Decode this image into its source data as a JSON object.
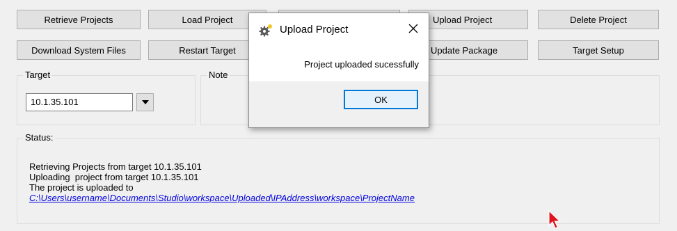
{
  "toolbar": {
    "row1": [
      "Retrieve Projects",
      "Load Project",
      "",
      "Upload Project",
      "Delete Project"
    ],
    "row2": [
      "Download System Files",
      "Restart Target",
      "",
      "Update Package",
      "Target Setup"
    ]
  },
  "target_group": {
    "label": "Target",
    "value": "10.1.35.101"
  },
  "note_group": {
    "label": "Note"
  },
  "status_group": {
    "label": "Status:",
    "lines": [
      "Retrieving Projects from target 10.1.35.101",
      "Uploading  project from target 10.1.35.101",
      "The project is uploaded to"
    ],
    "link": "C:\\Users\\username\\Documents\\Studio\\workspace\\Uploaded\\IPAddress\\workspace\\ProjectName"
  },
  "dialog": {
    "title": "Upload Project",
    "message": "Project uploaded sucessfully",
    "ok_label": "OK",
    "icon": "gear-icon",
    "close_icon": "close-icon"
  },
  "colors": {
    "accent": "#0078d7",
    "link": "#0000e0",
    "cursor": "#e0141e"
  }
}
